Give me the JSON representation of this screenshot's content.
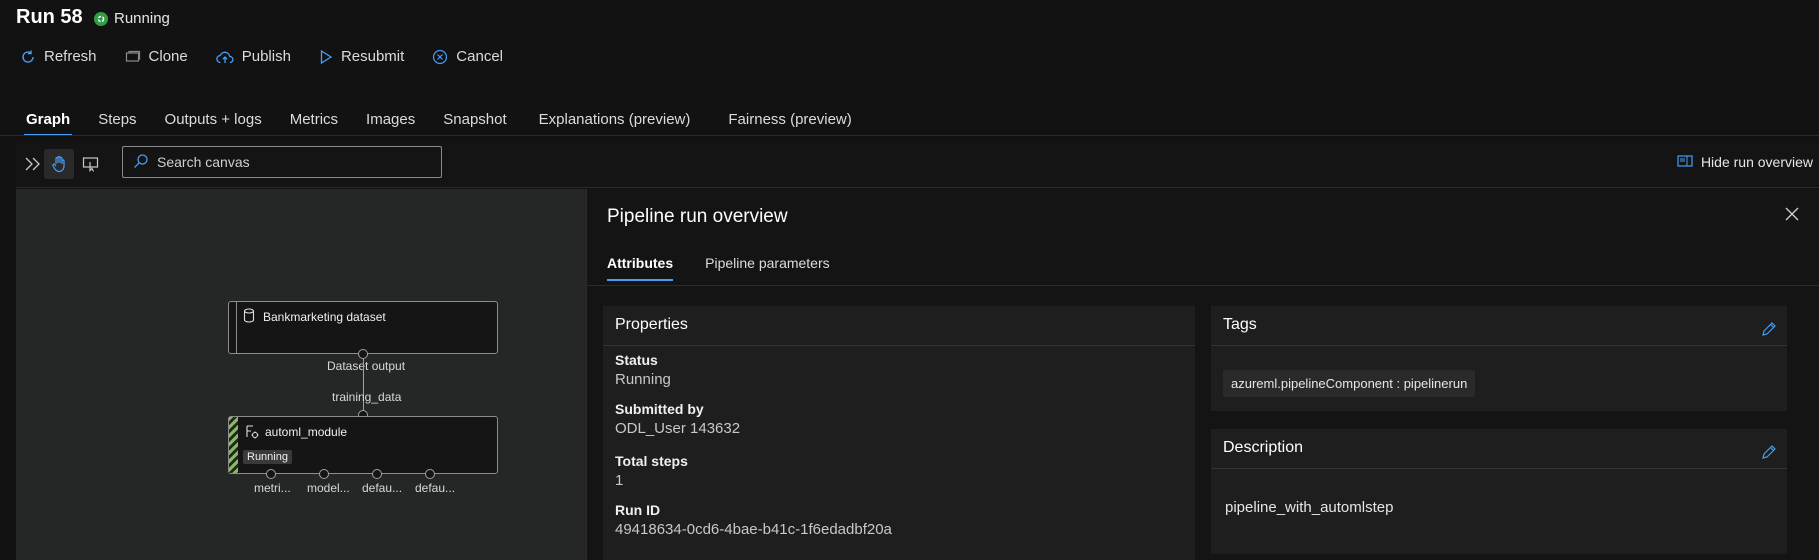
{
  "header": {
    "title": "Run 58",
    "status": "Running",
    "status_color": "#2f9e44"
  },
  "toolbar": {
    "refresh": "Refresh",
    "clone": "Clone",
    "publish": "Publish",
    "resubmit": "Resubmit",
    "cancel": "Cancel"
  },
  "tabs": [
    {
      "label": "Graph",
      "active": true
    },
    {
      "label": "Steps"
    },
    {
      "label": "Outputs + logs"
    },
    {
      "label": "Metrics"
    },
    {
      "label": "Images"
    },
    {
      "label": "Snapshot"
    },
    {
      "label": "Explanations (preview)"
    },
    {
      "label": "Fairness (preview)"
    }
  ],
  "canvas_toolbar": {
    "search_placeholder": "Search canvas",
    "hide_overview": "Hide run overview"
  },
  "graph": {
    "node1": {
      "label": "Bankmarketing dataset",
      "output_label": "Dataset output"
    },
    "edge_label": "training_data",
    "node2": {
      "label": "automl_module",
      "status": "Running",
      "status_color": "#8db568"
    },
    "outputs": [
      "metri...",
      "model...",
      "defau...",
      "defau..."
    ]
  },
  "panel": {
    "title": "Pipeline run overview",
    "tabs": [
      {
        "label": "Attributes",
        "active": true
      },
      {
        "label": "Pipeline parameters"
      }
    ],
    "properties": {
      "title": "Properties",
      "status_label": "Status",
      "status_value": "Running",
      "submitted_label": "Submitted by",
      "submitted_value": "ODL_User 143632",
      "steps_label": "Total steps",
      "steps_value": "1",
      "runid_label": "Run ID",
      "runid_value": "49418634-0cd6-4bae-b41c-1f6edadbf20a"
    },
    "tags": {
      "title": "Tags",
      "items": [
        "azureml.pipelineComponent : pipelinerun"
      ]
    },
    "description": {
      "title": "Description",
      "text": "pipeline_with_automlstep"
    }
  },
  "accent_color": "#479ef5"
}
